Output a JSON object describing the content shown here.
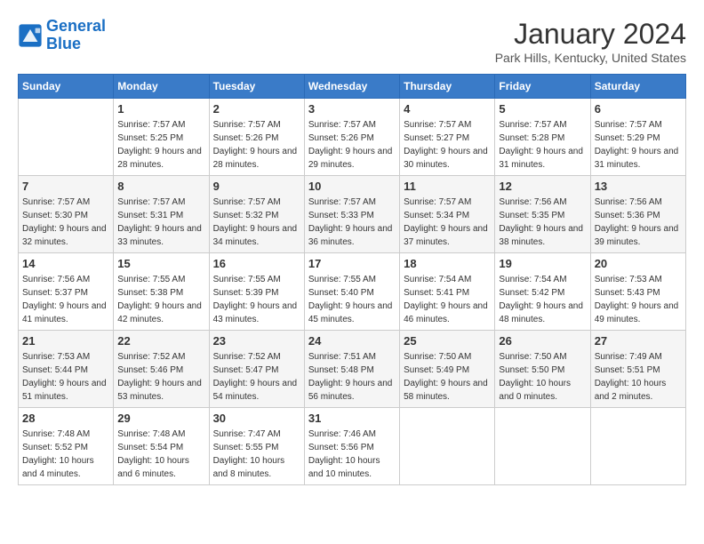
{
  "logo": {
    "text_general": "General",
    "text_blue": "Blue"
  },
  "title": "January 2024",
  "location": "Park Hills, Kentucky, United States",
  "headers": [
    "Sunday",
    "Monday",
    "Tuesday",
    "Wednesday",
    "Thursday",
    "Friday",
    "Saturday"
  ],
  "weeks": [
    [
      {
        "day": "",
        "sunrise": "",
        "sunset": "",
        "daylight": ""
      },
      {
        "day": "1",
        "sunrise": "Sunrise: 7:57 AM",
        "sunset": "Sunset: 5:25 PM",
        "daylight": "Daylight: 9 hours and 28 minutes."
      },
      {
        "day": "2",
        "sunrise": "Sunrise: 7:57 AM",
        "sunset": "Sunset: 5:26 PM",
        "daylight": "Daylight: 9 hours and 28 minutes."
      },
      {
        "day": "3",
        "sunrise": "Sunrise: 7:57 AM",
        "sunset": "Sunset: 5:26 PM",
        "daylight": "Daylight: 9 hours and 29 minutes."
      },
      {
        "day": "4",
        "sunrise": "Sunrise: 7:57 AM",
        "sunset": "Sunset: 5:27 PM",
        "daylight": "Daylight: 9 hours and 30 minutes."
      },
      {
        "day": "5",
        "sunrise": "Sunrise: 7:57 AM",
        "sunset": "Sunset: 5:28 PM",
        "daylight": "Daylight: 9 hours and 31 minutes."
      },
      {
        "day": "6",
        "sunrise": "Sunrise: 7:57 AM",
        "sunset": "Sunset: 5:29 PM",
        "daylight": "Daylight: 9 hours and 31 minutes."
      }
    ],
    [
      {
        "day": "7",
        "sunrise": "Sunrise: 7:57 AM",
        "sunset": "Sunset: 5:30 PM",
        "daylight": "Daylight: 9 hours and 32 minutes."
      },
      {
        "day": "8",
        "sunrise": "Sunrise: 7:57 AM",
        "sunset": "Sunset: 5:31 PM",
        "daylight": "Daylight: 9 hours and 33 minutes."
      },
      {
        "day": "9",
        "sunrise": "Sunrise: 7:57 AM",
        "sunset": "Sunset: 5:32 PM",
        "daylight": "Daylight: 9 hours and 34 minutes."
      },
      {
        "day": "10",
        "sunrise": "Sunrise: 7:57 AM",
        "sunset": "Sunset: 5:33 PM",
        "daylight": "Daylight: 9 hours and 36 minutes."
      },
      {
        "day": "11",
        "sunrise": "Sunrise: 7:57 AM",
        "sunset": "Sunset: 5:34 PM",
        "daylight": "Daylight: 9 hours and 37 minutes."
      },
      {
        "day": "12",
        "sunrise": "Sunrise: 7:56 AM",
        "sunset": "Sunset: 5:35 PM",
        "daylight": "Daylight: 9 hours and 38 minutes."
      },
      {
        "day": "13",
        "sunrise": "Sunrise: 7:56 AM",
        "sunset": "Sunset: 5:36 PM",
        "daylight": "Daylight: 9 hours and 39 minutes."
      }
    ],
    [
      {
        "day": "14",
        "sunrise": "Sunrise: 7:56 AM",
        "sunset": "Sunset: 5:37 PM",
        "daylight": "Daylight: 9 hours and 41 minutes."
      },
      {
        "day": "15",
        "sunrise": "Sunrise: 7:55 AM",
        "sunset": "Sunset: 5:38 PM",
        "daylight": "Daylight: 9 hours and 42 minutes."
      },
      {
        "day": "16",
        "sunrise": "Sunrise: 7:55 AM",
        "sunset": "Sunset: 5:39 PM",
        "daylight": "Daylight: 9 hours and 43 minutes."
      },
      {
        "day": "17",
        "sunrise": "Sunrise: 7:55 AM",
        "sunset": "Sunset: 5:40 PM",
        "daylight": "Daylight: 9 hours and 45 minutes."
      },
      {
        "day": "18",
        "sunrise": "Sunrise: 7:54 AM",
        "sunset": "Sunset: 5:41 PM",
        "daylight": "Daylight: 9 hours and 46 minutes."
      },
      {
        "day": "19",
        "sunrise": "Sunrise: 7:54 AM",
        "sunset": "Sunset: 5:42 PM",
        "daylight": "Daylight: 9 hours and 48 minutes."
      },
      {
        "day": "20",
        "sunrise": "Sunrise: 7:53 AM",
        "sunset": "Sunset: 5:43 PM",
        "daylight": "Daylight: 9 hours and 49 minutes."
      }
    ],
    [
      {
        "day": "21",
        "sunrise": "Sunrise: 7:53 AM",
        "sunset": "Sunset: 5:44 PM",
        "daylight": "Daylight: 9 hours and 51 minutes."
      },
      {
        "day": "22",
        "sunrise": "Sunrise: 7:52 AM",
        "sunset": "Sunset: 5:46 PM",
        "daylight": "Daylight: 9 hours and 53 minutes."
      },
      {
        "day": "23",
        "sunrise": "Sunrise: 7:52 AM",
        "sunset": "Sunset: 5:47 PM",
        "daylight": "Daylight: 9 hours and 54 minutes."
      },
      {
        "day": "24",
        "sunrise": "Sunrise: 7:51 AM",
        "sunset": "Sunset: 5:48 PM",
        "daylight": "Daylight: 9 hours and 56 minutes."
      },
      {
        "day": "25",
        "sunrise": "Sunrise: 7:50 AM",
        "sunset": "Sunset: 5:49 PM",
        "daylight": "Daylight: 9 hours and 58 minutes."
      },
      {
        "day": "26",
        "sunrise": "Sunrise: 7:50 AM",
        "sunset": "Sunset: 5:50 PM",
        "daylight": "Daylight: 10 hours and 0 minutes."
      },
      {
        "day": "27",
        "sunrise": "Sunrise: 7:49 AM",
        "sunset": "Sunset: 5:51 PM",
        "daylight": "Daylight: 10 hours and 2 minutes."
      }
    ],
    [
      {
        "day": "28",
        "sunrise": "Sunrise: 7:48 AM",
        "sunset": "Sunset: 5:52 PM",
        "daylight": "Daylight: 10 hours and 4 minutes."
      },
      {
        "day": "29",
        "sunrise": "Sunrise: 7:48 AM",
        "sunset": "Sunset: 5:54 PM",
        "daylight": "Daylight: 10 hours and 6 minutes."
      },
      {
        "day": "30",
        "sunrise": "Sunrise: 7:47 AM",
        "sunset": "Sunset: 5:55 PM",
        "daylight": "Daylight: 10 hours and 8 minutes."
      },
      {
        "day": "31",
        "sunrise": "Sunrise: 7:46 AM",
        "sunset": "Sunset: 5:56 PM",
        "daylight": "Daylight: 10 hours and 10 minutes."
      },
      {
        "day": "",
        "sunrise": "",
        "sunset": "",
        "daylight": ""
      },
      {
        "day": "",
        "sunrise": "",
        "sunset": "",
        "daylight": ""
      },
      {
        "day": "",
        "sunrise": "",
        "sunset": "",
        "daylight": ""
      }
    ]
  ]
}
